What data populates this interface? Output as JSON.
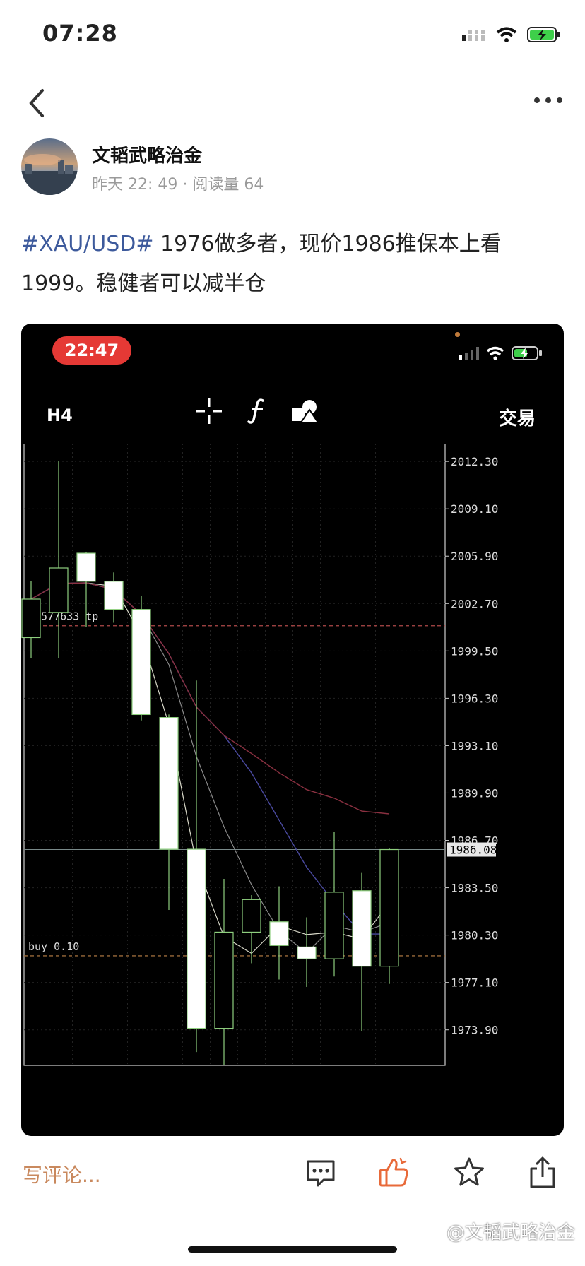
{
  "status_bar": {
    "time": "07:28"
  },
  "author": {
    "name": "文韬武略治金",
    "meta": "昨天 22: 49 · 阅读量 64"
  },
  "post": {
    "hashtag": "#XAU/USD#",
    "text": " 1976做多者，现价1986推保本上看1999。稳健者可以减半仓"
  },
  "screenshot": {
    "status_time": "22:47",
    "timeframe": "H4",
    "trade_label": "交易",
    "toolbar_icons": [
      "crosshair-icon",
      "function-icon",
      "objects-icon"
    ],
    "chart_data": {
      "type": "candlestick",
      "symbol": "XAU/USD",
      "timeframe": "H4",
      "y_ticks": [
        "2012.30",
        "2009.10",
        "2005.90",
        "2002.70",
        "1999.50",
        "1996.30",
        "1993.10",
        "1989.90",
        "1986.70",
        "1986.08",
        "1983.50",
        "1980.30",
        "1977.10",
        "1973.90"
      ],
      "ylim": [
        1971.5,
        2013.5
      ],
      "current_price": 1986.08,
      "order_lines": [
        {
          "label": "#4577633 tp",
          "price": 2001.2,
          "color": "#b04a4a"
        },
        {
          "label": "buy 0.10",
          "price": 1978.9,
          "color": "#9a6a3a"
        }
      ],
      "candles": [
        {
          "open": 2000.4,
          "high": 2004.2,
          "low": 1999.0,
          "close": 2003.0
        },
        {
          "open": 2002.1,
          "high": 2012.3,
          "low": 1999.0,
          "close": 2005.1
        },
        {
          "open": 2006.1,
          "high": 2006.2,
          "low": 2001.1,
          "close": 2004.2
        },
        {
          "open": 2004.2,
          "high": 2004.8,
          "low": 2001.4,
          "close": 2002.3
        },
        {
          "open": 2002.3,
          "high": 2003.2,
          "low": 1994.8,
          "close": 1995.2
        },
        {
          "open": 1995.0,
          "high": 1995.2,
          "low": 1982.0,
          "close": 1986.1
        },
        {
          "open": 1986.1,
          "high": 1997.5,
          "low": 1972.4,
          "close": 1974.0
        },
        {
          "open": 1974.0,
          "high": 1984.1,
          "low": 1971.5,
          "close": 1980.5
        },
        {
          "open": 1980.5,
          "high": 1983.0,
          "low": 1978.4,
          "close": 1982.7
        },
        {
          "open": 1981.2,
          "high": 1983.6,
          "low": 1977.3,
          "close": 1979.6
        },
        {
          "open": 1979.5,
          "high": 1981.5,
          "low": 1976.8,
          "close": 1978.7
        },
        {
          "open": 1978.7,
          "high": 1987.3,
          "low": 1977.5,
          "close": 1983.2
        },
        {
          "open": 1983.3,
          "high": 1984.5,
          "low": 1973.8,
          "close": 1978.2
        },
        {
          "open": 1978.2,
          "high": 1986.2,
          "low": 1977.0,
          "close": 1986.08
        }
      ],
      "grid": true
    }
  },
  "bottom_bar": {
    "comment_label": "写评论...",
    "icons": [
      "comment-icon",
      "like-icon",
      "star-icon",
      "share-icon"
    ],
    "watermark": "@文韬武略治金"
  }
}
